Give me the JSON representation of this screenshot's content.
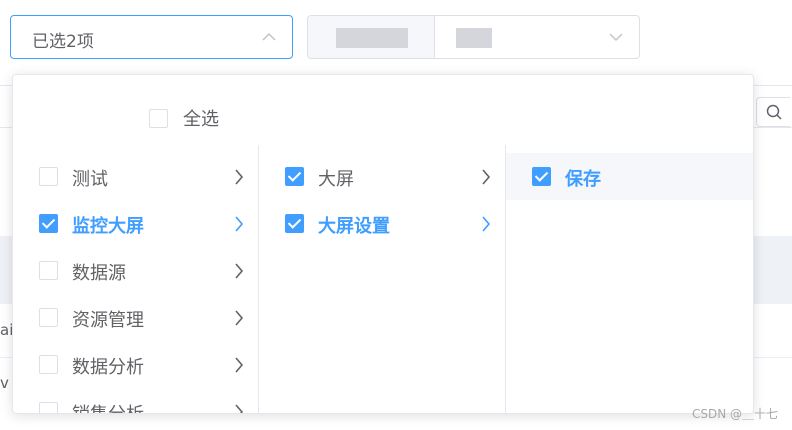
{
  "select_main": {
    "value": "已选2项"
  },
  "select_all": {
    "label": "全选",
    "checked": false
  },
  "panels": [
    {
      "nodes": [
        {
          "label": "测试",
          "checked": false,
          "active": false
        },
        {
          "label": "监控大屏",
          "checked": true,
          "active": true
        },
        {
          "label": "数据源",
          "checked": false,
          "active": false
        },
        {
          "label": "资源管理",
          "checked": false,
          "active": false
        },
        {
          "label": "数据分析",
          "checked": false,
          "active": false
        },
        {
          "label": "销售分析",
          "checked": false,
          "active": false
        }
      ]
    },
    {
      "nodes": [
        {
          "label": "大屏",
          "checked": true,
          "active": false
        },
        {
          "label": "大屏设置",
          "checked": true,
          "active": true
        }
      ]
    },
    {
      "nodes": [
        {
          "label": "保存",
          "checked": true,
          "active": true
        }
      ]
    }
  ],
  "background": {
    "row_text_1": "ai",
    "row_text_2": "v"
  },
  "watermark": "CSDN @＿十七",
  "colors": {
    "accent": "#409eff",
    "text": "#606266",
    "border": "#dcdfe6",
    "hover": "#f5f7fa"
  },
  "icons": {
    "dropdown_arrow": "chevron-up-icon",
    "select2_arrow": "chevron-down-icon",
    "expand": "chevron-right-icon",
    "search": "search-icon"
  }
}
